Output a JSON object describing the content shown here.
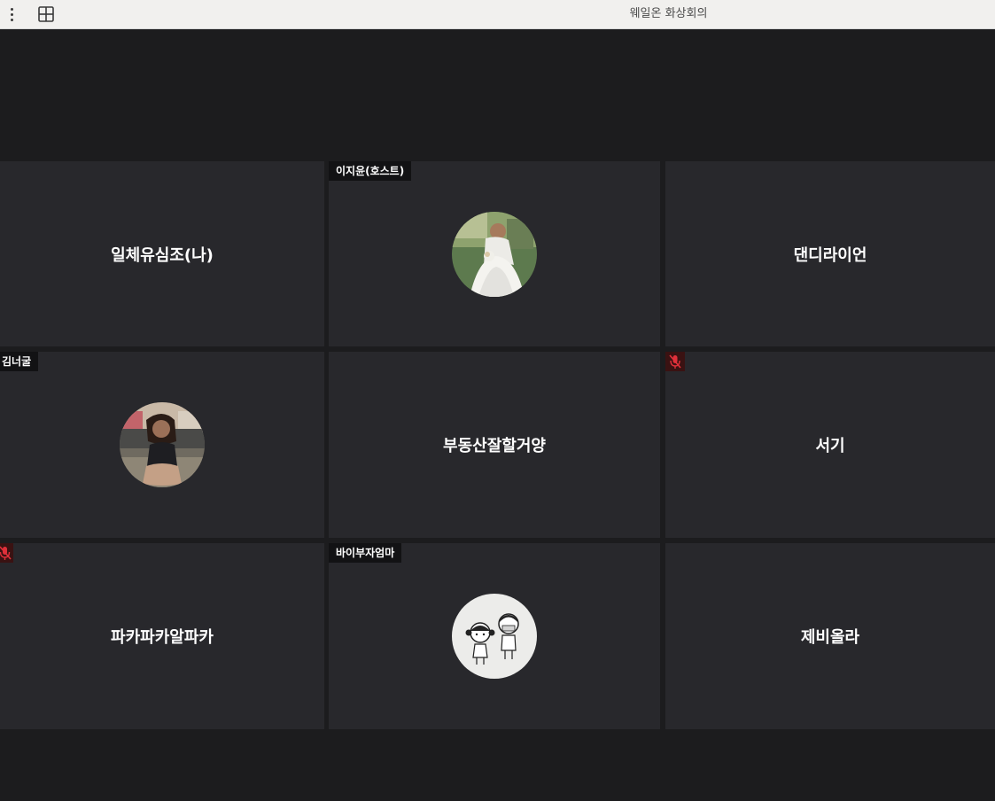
{
  "window": {
    "title": "웨일온 화상회의",
    "menu_icon": "more-vertical-icon",
    "layout_icon": "grid-layout-icon"
  },
  "participants": [
    {
      "name": "일체유심조(나)",
      "display": "name",
      "tag": "",
      "muted": false
    },
    {
      "name": "이지윤(호스트)",
      "display": "avatar",
      "tag": "이지윤(호스트)",
      "avatar": "bride-photo",
      "muted": false
    },
    {
      "name": "댄디라이언",
      "display": "name",
      "tag": "",
      "muted": false
    },
    {
      "name": "김너굴",
      "display": "avatar",
      "tag": "김너굴",
      "avatar": "girl-photo",
      "muted": false
    },
    {
      "name": "부동산잘할거양",
      "display": "name",
      "tag": "",
      "muted": false
    },
    {
      "name": "서기",
      "display": "name",
      "tag": "",
      "muted": true
    },
    {
      "name": "파카파카알파카",
      "display": "name",
      "tag": "",
      "muted": true
    },
    {
      "name": "바이부자엄마",
      "display": "avatar",
      "tag": "바이부자엄마",
      "avatar": "kids-drawing",
      "muted": false
    },
    {
      "name": "제비올라",
      "display": "name",
      "tag": "",
      "muted": false
    }
  ],
  "colors": {
    "background": "#1c1c1e",
    "tile": "#28282c",
    "muted_indicator": "#e0303a",
    "titlebar": "#f1f0ee"
  }
}
